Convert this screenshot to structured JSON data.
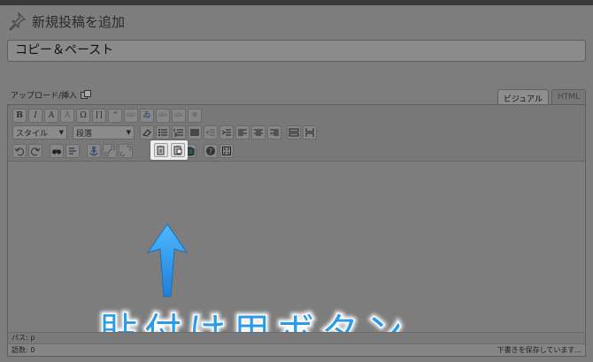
{
  "page": {
    "title": "新規投稿を追加"
  },
  "post": {
    "title_value": "コピー＆ペースト"
  },
  "upload": {
    "label": "アップロード/挿入"
  },
  "tabs": [
    {
      "label": "ビジュアル"
    },
    {
      "label": "HTML"
    }
  ],
  "toolbar": {
    "row1": [
      "B",
      "I",
      "A",
      "A",
      "Ω",
      "⌈⌉",
      "“",
      "abc",
      "ゐ",
      "abc",
      "abc",
      "※"
    ],
    "style_select": "スタイル",
    "format_select": "段落",
    "paste_text_icon": "paste-as-text-icon",
    "paste_word_icon": "paste-from-word-icon"
  },
  "annotation": {
    "text": "貼付け用ボタン",
    "color": "#2b9be8"
  },
  "status": {
    "path": "パス: p"
  },
  "footer": {
    "word_count": "語数: 0",
    "save_status": "下書きを保存しています..."
  }
}
